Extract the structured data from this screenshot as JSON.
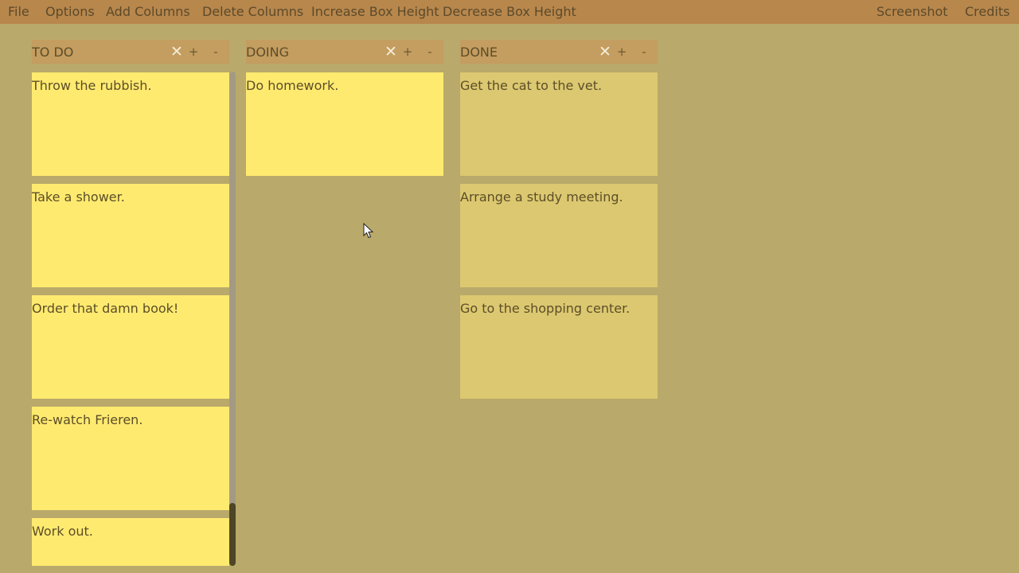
{
  "menubar": {
    "file": "File",
    "options": "Options",
    "add_columns": "Add Columns",
    "delete_columns": "Delete Columns",
    "increase_box_height": "Increase Box Height",
    "decrease_box_height": "Decrease Box Height",
    "screenshot": "Screenshot",
    "credits": "Credits"
  },
  "columns": [
    {
      "title": "TO DO",
      "close": "✕",
      "add": "+",
      "remove": "-",
      "cards": [
        "Throw the rubbish.",
        "Take a shower.",
        "Order that damn book!",
        "Re-watch Frieren.",
        "Work out."
      ]
    },
    {
      "title": "DOING",
      "close": "✕",
      "add": "+",
      "remove": "-",
      "cards": [
        "Do homework."
      ]
    },
    {
      "title": "DONE",
      "close": "✕",
      "add": "+",
      "remove": "-",
      "cards": [
        "Get the cat to the vet.",
        "Arrange a study meeting.",
        "Go to the shopping center."
      ]
    }
  ],
  "colors": {
    "background": "#b9a96a",
    "menubar": "#b8874c",
    "column_header": "#c49d60",
    "card": "#ffea70",
    "card_done": "#dcc870",
    "text": "#5c4e28"
  }
}
